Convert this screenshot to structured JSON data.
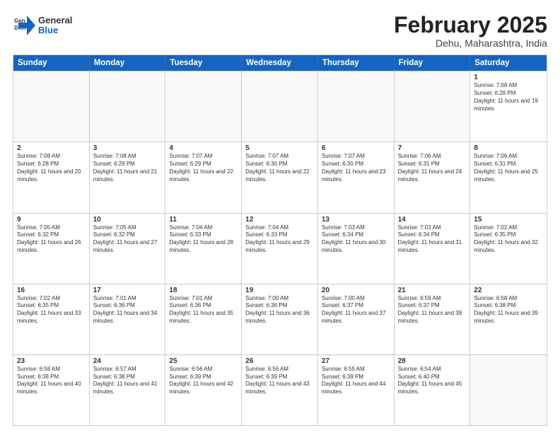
{
  "header": {
    "logo": {
      "general": "General",
      "blue": "Blue"
    },
    "title": "February 2025",
    "location": "Dehu, Maharashtra, India"
  },
  "weekdays": [
    "Sunday",
    "Monday",
    "Tuesday",
    "Wednesday",
    "Thursday",
    "Friday",
    "Saturday"
  ],
  "weeks": [
    [
      {
        "day": "",
        "info": ""
      },
      {
        "day": "",
        "info": ""
      },
      {
        "day": "",
        "info": ""
      },
      {
        "day": "",
        "info": ""
      },
      {
        "day": "",
        "info": ""
      },
      {
        "day": "",
        "info": ""
      },
      {
        "day": "1",
        "info": "Sunrise: 7:08 AM\nSunset: 6:28 PM\nDaylight: 11 hours and 19 minutes."
      }
    ],
    [
      {
        "day": "2",
        "info": "Sunrise: 7:08 AM\nSunset: 6:28 PM\nDaylight: 11 hours and 20 minutes."
      },
      {
        "day": "3",
        "info": "Sunrise: 7:08 AM\nSunset: 6:29 PM\nDaylight: 11 hours and 21 minutes."
      },
      {
        "day": "4",
        "info": "Sunrise: 7:07 AM\nSunset: 6:29 PM\nDaylight: 11 hours and 22 minutes."
      },
      {
        "day": "5",
        "info": "Sunrise: 7:07 AM\nSunset: 6:30 PM\nDaylight: 11 hours and 22 minutes."
      },
      {
        "day": "6",
        "info": "Sunrise: 7:07 AM\nSunset: 6:30 PM\nDaylight: 11 hours and 23 minutes."
      },
      {
        "day": "7",
        "info": "Sunrise: 7:06 AM\nSunset: 6:31 PM\nDaylight: 11 hours and 24 minutes."
      },
      {
        "day": "8",
        "info": "Sunrise: 7:06 AM\nSunset: 6:31 PM\nDaylight: 11 hours and 25 minutes."
      }
    ],
    [
      {
        "day": "9",
        "info": "Sunrise: 7:05 AM\nSunset: 6:32 PM\nDaylight: 11 hours and 26 minutes."
      },
      {
        "day": "10",
        "info": "Sunrise: 7:05 AM\nSunset: 6:32 PM\nDaylight: 11 hours and 27 minutes."
      },
      {
        "day": "11",
        "info": "Sunrise: 7:04 AM\nSunset: 6:33 PM\nDaylight: 11 hours and 28 minutes."
      },
      {
        "day": "12",
        "info": "Sunrise: 7:04 AM\nSunset: 6:33 PM\nDaylight: 11 hours and 29 minutes."
      },
      {
        "day": "13",
        "info": "Sunrise: 7:03 AM\nSunset: 6:34 PM\nDaylight: 11 hours and 30 minutes."
      },
      {
        "day": "14",
        "info": "Sunrise: 7:03 AM\nSunset: 6:34 PM\nDaylight: 11 hours and 31 minutes."
      },
      {
        "day": "15",
        "info": "Sunrise: 7:02 AM\nSunset: 6:35 PM\nDaylight: 11 hours and 32 minutes."
      }
    ],
    [
      {
        "day": "16",
        "info": "Sunrise: 7:02 AM\nSunset: 6:35 PM\nDaylight: 11 hours and 33 minutes."
      },
      {
        "day": "17",
        "info": "Sunrise: 7:01 AM\nSunset: 6:36 PM\nDaylight: 11 hours and 34 minutes."
      },
      {
        "day": "18",
        "info": "Sunrise: 7:01 AM\nSunset: 6:36 PM\nDaylight: 11 hours and 35 minutes."
      },
      {
        "day": "19",
        "info": "Sunrise: 7:00 AM\nSunset: 6:36 PM\nDaylight: 11 hours and 36 minutes."
      },
      {
        "day": "20",
        "info": "Sunrise: 7:00 AM\nSunset: 6:37 PM\nDaylight: 11 hours and 37 minutes."
      },
      {
        "day": "21",
        "info": "Sunrise: 6:59 AM\nSunset: 6:37 PM\nDaylight: 11 hours and 38 minutes."
      },
      {
        "day": "22",
        "info": "Sunrise: 6:58 AM\nSunset: 6:38 PM\nDaylight: 11 hours and 39 minutes."
      }
    ],
    [
      {
        "day": "23",
        "info": "Sunrise: 6:58 AM\nSunset: 6:38 PM\nDaylight: 11 hours and 40 minutes."
      },
      {
        "day": "24",
        "info": "Sunrise: 6:57 AM\nSunset: 6:38 PM\nDaylight: 11 hours and 41 minutes."
      },
      {
        "day": "25",
        "info": "Sunrise: 6:56 AM\nSunset: 6:39 PM\nDaylight: 11 hours and 42 minutes."
      },
      {
        "day": "26",
        "info": "Sunrise: 6:56 AM\nSunset: 6:39 PM\nDaylight: 11 hours and 43 minutes."
      },
      {
        "day": "27",
        "info": "Sunrise: 6:55 AM\nSunset: 6:39 PM\nDaylight: 11 hours and 44 minutes."
      },
      {
        "day": "28",
        "info": "Sunrise: 6:54 AM\nSunset: 6:40 PM\nDaylight: 11 hours and 45 minutes."
      },
      {
        "day": "",
        "info": ""
      }
    ]
  ]
}
